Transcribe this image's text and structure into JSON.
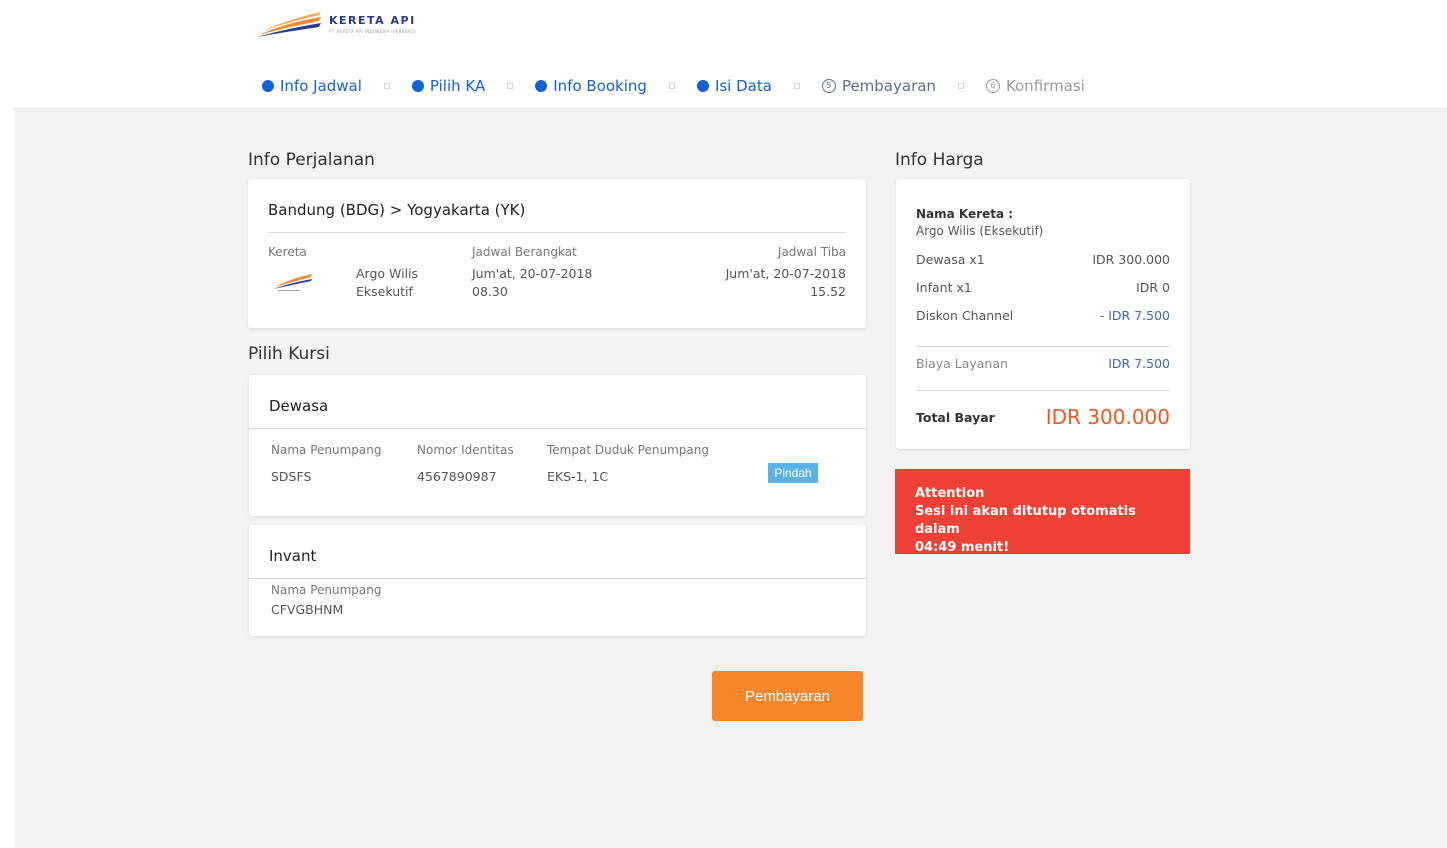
{
  "brand": {
    "name": "KERETA API",
    "tagline": "PT. KERETA API INDONESIA (PERSERO)",
    "colors": {
      "primary": "#2a3c8f",
      "accent": "#f5862b",
      "alert": "#f04136",
      "step_active": "#1460d6"
    }
  },
  "steps": [
    {
      "label": "Info Jadwal",
      "state": "done"
    },
    {
      "label": "Pilih KA",
      "state": "done"
    },
    {
      "label": "Info Booking",
      "state": "done"
    },
    {
      "label": "Isi Data",
      "state": "done"
    },
    {
      "label": "Pembayaran",
      "state": "current",
      "number": "5"
    },
    {
      "label": "Konfirmasi",
      "state": "todo",
      "number": "6"
    }
  ],
  "trip": {
    "section_title": "Info Perjalanan",
    "route": "Bandung (BDG) > Yogyakarta (YK)",
    "train_label": "Kereta",
    "train_name_1": "Argo Wilis",
    "train_name_2": "Eksekutif",
    "depart_label": "Jadwal Berangkat",
    "depart_date": "Jum'at, 20-07-2018",
    "depart_time": "08.30",
    "arrive_label": "Jadwal Tiba",
    "arrive_date": "Jum'at, 20-07-2018",
    "arrive_time": "15.52"
  },
  "seats": {
    "section_title": "Pilih Kursi",
    "adult": {
      "title": "Dewasa",
      "col_name": "Nama Penumpang",
      "col_id": "Nomor Identitas",
      "col_seat": "Tempat Duduk Penumpang",
      "name": "SDSFS",
      "id": "4567890987",
      "seat": "EKS-1, 1C",
      "move_button": "Pindah"
    },
    "infant": {
      "title": "Invant",
      "col_name": "Nama Penumpang",
      "name": "CFVGBHNM"
    }
  },
  "pay_button": "Pembayaran",
  "price": {
    "section_title": "Info Harga",
    "train_label": "Nama Kereta :",
    "train_value": "Argo Wilis (Eksekutif)",
    "rows": [
      {
        "label": "Dewasa x1",
        "value": "IDR 300.000"
      },
      {
        "label": "Infant x1",
        "value": "IDR 0"
      },
      {
        "label": "Diskon Channel",
        "value": "- IDR 7.500"
      }
    ],
    "fee_label": "Biaya Layanan",
    "fee_value": "IDR 7.500",
    "total_label": "Total Bayar",
    "total_value": "IDR 300.000"
  },
  "alert": {
    "title": "Attention",
    "message": "Sesi ini akan ditutup otomatis dalam",
    "countdown": "04:49 menit!"
  }
}
